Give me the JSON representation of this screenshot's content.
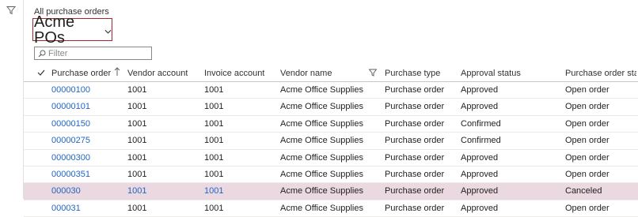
{
  "page": {
    "caption": "All purchase orders",
    "view_title": "Acme POs",
    "filter_placeholder": "Filter"
  },
  "icons": {
    "filter_pane": "funnel-icon",
    "view_dropdown": "chevron-down-icon",
    "filter_search": "search-icon",
    "select_all": "checkmark-icon",
    "sort": "sort-ascending-icon",
    "column_filter": "funnel-icon"
  },
  "grid": {
    "columns": {
      "purchase_order": "Purchase order",
      "vendor_account": "Vendor account",
      "invoice_account": "Invoice account",
      "vendor_name": "Vendor name",
      "purchase_type": "Purchase type",
      "approval_status": "Approval status",
      "po_status": "Purchase order sta..."
    },
    "rows": [
      {
        "po": "00000100",
        "va": "1001",
        "ia": "1001",
        "vn": "Acme Office Supplies",
        "pt": "Purchase order",
        "as": "Approved",
        "ps": "Open order"
      },
      {
        "po": "00000101",
        "va": "1001",
        "ia": "1001",
        "vn": "Acme Office Supplies",
        "pt": "Purchase order",
        "as": "Approved",
        "ps": "Open order"
      },
      {
        "po": "00000150",
        "va": "1001",
        "ia": "1001",
        "vn": "Acme Office Supplies",
        "pt": "Purchase order",
        "as": "Confirmed",
        "ps": "Open order"
      },
      {
        "po": "00000275",
        "va": "1001",
        "ia": "1001",
        "vn": "Acme Office Supplies",
        "pt": "Purchase order",
        "as": "Confirmed",
        "ps": "Open order"
      },
      {
        "po": "00000300",
        "va": "1001",
        "ia": "1001",
        "vn": "Acme Office Supplies",
        "pt": "Purchase order",
        "as": "Approved",
        "ps": "Open order"
      },
      {
        "po": "00000351",
        "va": "1001",
        "ia": "1001",
        "vn": "Acme Office Supplies",
        "pt": "Purchase order",
        "as": "Approved",
        "ps": "Open order"
      },
      {
        "po": "000030",
        "va": "1001",
        "ia": "1001",
        "vn": "Acme Office Supplies",
        "pt": "Purchase order",
        "as": "Approved",
        "ps": "Canceled"
      },
      {
        "po": "000031",
        "va": "1001",
        "ia": "1001",
        "vn": "Acme Office Supplies",
        "pt": "Purchase order",
        "as": "Approved",
        "ps": "Open order"
      }
    ]
  },
  "colors": {
    "accent_border": "#a4262c",
    "link": "#2166c2",
    "selected_row": "#ead9e0"
  }
}
